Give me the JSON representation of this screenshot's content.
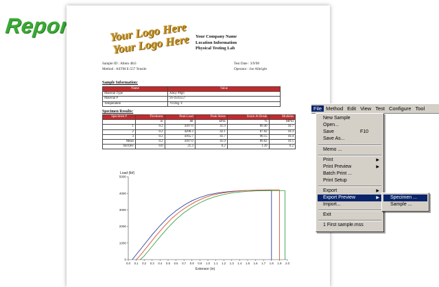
{
  "badge": {
    "title": "Report"
  },
  "report": {
    "logo_lines": [
      "Your Logo Here",
      "Your Logo Here"
    ],
    "company": {
      "name": "Your Company Name",
      "location": "Location Information",
      "lab": "Physical Testing Lab"
    },
    "meta": {
      "sample_id": "Sample ID : Altem 4lb3",
      "method": "Method    : ASTM E-557 Tensile",
      "test_date": "Test Date : 3/9/98",
      "operator": "Operator  : Joe Albright"
    },
    "sample_info": {
      "heading": "Sample Information:",
      "headers": [
        "Name",
        "Value"
      ],
      "rows": [
        [
          "Material Type",
          "Alloy #8g6"
        ],
        [
          "Material #",
          "56-4545557"
        ],
        [
          "Temperature",
          "70 Deg. F"
        ]
      ]
    },
    "specimen_results": {
      "heading": "Specimen Results:",
      "headers": [
        "Specimen #",
        "Thickness",
        "Peak Load",
        "Peak Stress",
        "Strain At Break",
        "Modulus"
      ],
      "units": [
        "",
        "in",
        "lbf",
        "kPSI",
        "%",
        "MPSI"
      ],
      "rows": [
        [
          "1",
          "0.2",
          "4187.0",
          "41.9",
          "89.40",
          "10.7"
        ],
        [
          "2",
          "0.2",
          "4208.3",
          "42.1",
          "87.02",
          "10.3"
        ],
        [
          "3",
          "0.2",
          "4165.7",
          "41.7",
          "90.15",
          "10.4"
        ],
        [
          "Mean",
          "0.2",
          "4187.0",
          "41.9",
          "89.02",
          "10.5"
        ],
        [
          "Std Dev",
          "0.0",
          "21.3",
          "0.2",
          "1.39",
          "0.2"
        ]
      ]
    }
  },
  "chart_data": {
    "type": "line",
    "ylabel": "Load (lbf)",
    "xlabel": "Extensor (in)",
    "ylim": [
      0,
      5000
    ],
    "xlim": [
      0,
      2.0
    ],
    "yticks": [
      "0",
      "1000",
      "2000",
      "3000",
      "4000",
      "5000"
    ],
    "xticks": [
      "0.0",
      "0.1",
      "0.2",
      "0.3",
      "0.4",
      "0.5",
      "0.6",
      "0.7",
      "0.8",
      "0.9",
      "1.0",
      "1.1",
      "1.2",
      "1.3",
      "1.4",
      "1.5",
      "1.6",
      "1.7",
      "1.8",
      "1.9",
      "2.0"
    ],
    "series": [
      {
        "color": "#2c3f9e",
        "break_x": 1.8,
        "points": [
          [
            0.05,
            0
          ],
          [
            0.1,
            300
          ],
          [
            0.2,
            900
          ],
          [
            0.3,
            1500
          ],
          [
            0.4,
            2050
          ],
          [
            0.5,
            2550
          ],
          [
            0.6,
            2950
          ],
          [
            0.7,
            3280
          ],
          [
            0.8,
            3550
          ],
          [
            0.9,
            3750
          ],
          [
            1.0,
            3900
          ],
          [
            1.1,
            4000
          ],
          [
            1.2,
            4070
          ],
          [
            1.3,
            4120
          ],
          [
            1.4,
            4150
          ],
          [
            1.5,
            4170
          ],
          [
            1.6,
            4180
          ],
          [
            1.7,
            4185
          ],
          [
            1.8,
            4187
          ]
        ]
      },
      {
        "color": "#d9502a",
        "break_x": 1.9,
        "points": [
          [
            0.1,
            0
          ],
          [
            0.15,
            250
          ],
          [
            0.25,
            850
          ],
          [
            0.35,
            1450
          ],
          [
            0.45,
            2000
          ],
          [
            0.55,
            2500
          ],
          [
            0.65,
            2900
          ],
          [
            0.75,
            3230
          ],
          [
            0.85,
            3500
          ],
          [
            0.95,
            3720
          ],
          [
            1.05,
            3880
          ],
          [
            1.15,
            3990
          ],
          [
            1.25,
            4070
          ],
          [
            1.35,
            4120
          ],
          [
            1.45,
            4160
          ],
          [
            1.55,
            4180
          ],
          [
            1.65,
            4195
          ],
          [
            1.75,
            4203
          ],
          [
            1.9,
            4208
          ]
        ]
      },
      {
        "color": "#3aa04a",
        "break_x": 1.97,
        "points": [
          [
            0.15,
            0
          ],
          [
            0.2,
            220
          ],
          [
            0.3,
            800
          ],
          [
            0.4,
            1380
          ],
          [
            0.5,
            1930
          ],
          [
            0.6,
            2420
          ],
          [
            0.7,
            2830
          ],
          [
            0.8,
            3160
          ],
          [
            0.9,
            3430
          ],
          [
            1.0,
            3650
          ],
          [
            1.1,
            3810
          ],
          [
            1.2,
            3930
          ],
          [
            1.3,
            4020
          ],
          [
            1.4,
            4080
          ],
          [
            1.5,
            4120
          ],
          [
            1.6,
            4145
          ],
          [
            1.7,
            4157
          ],
          [
            1.8,
            4163
          ],
          [
            1.97,
            4166
          ]
        ]
      }
    ]
  },
  "menubar": {
    "items": [
      "File",
      "Method",
      "Edit",
      "View",
      "Test",
      "Configure",
      "Tool"
    ]
  },
  "file_menu": {
    "items": [
      {
        "label": "New Sample",
        "shortcut": ""
      },
      {
        "label": "Open...",
        "shortcut": ""
      },
      {
        "label": "Save",
        "shortcut": "F10"
      },
      {
        "label": "Save As...",
        "shortcut": ""
      },
      {
        "label": "Memo ...",
        "shortcut": ""
      },
      {
        "label": "Print",
        "shortcut": ""
      },
      {
        "label": "Print Preview",
        "shortcut": ""
      },
      {
        "label": "Batch Print ...",
        "shortcut": ""
      },
      {
        "label": "Print Setup",
        "shortcut": ""
      },
      {
        "label": "Export",
        "shortcut": ""
      },
      {
        "label": "Export Preview",
        "shortcut": ""
      },
      {
        "label": "Import...",
        "shortcut": ""
      },
      {
        "label": "Exit",
        "shortcut": ""
      },
      {
        "label": "1 First sample.mss",
        "shortcut": ""
      }
    ]
  },
  "submenu": {
    "items": [
      "Specimen ...",
      "Sample ..."
    ]
  }
}
